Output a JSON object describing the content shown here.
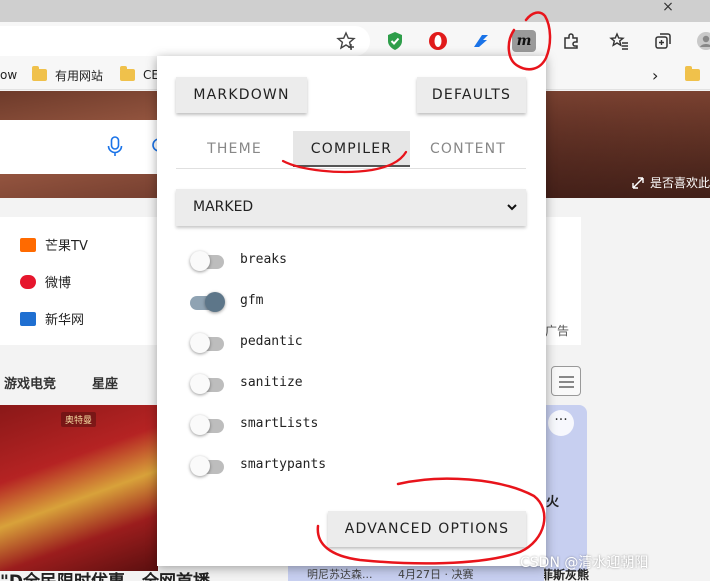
{
  "browser": {
    "tab_close": "×",
    "bookmarks": [
      {
        "label": "ow"
      },
      {
        "label": "有用网站"
      },
      {
        "label": "CE"
      }
    ],
    "overflow": "›"
  },
  "extension": {
    "icon_letter": "m",
    "buttons": {
      "markdown": "MARKDOWN",
      "defaults": "DEFAULTS",
      "advanced": "ADVANCED OPTIONS"
    },
    "tabs": [
      {
        "label": "THEME",
        "active": false
      },
      {
        "label": "COMPILER",
        "active": true
      },
      {
        "label": "CONTENT",
        "active": false
      }
    ],
    "compiler_select": {
      "value": "MARKED"
    },
    "options": [
      {
        "label": "breaks",
        "on": false
      },
      {
        "label": "gfm",
        "on": true
      },
      {
        "label": "pedantic",
        "on": false
      },
      {
        "label": "sanitize",
        "on": false
      },
      {
        "label": "smartLists",
        "on": false
      },
      {
        "label": "smartypants",
        "on": false
      }
    ]
  },
  "page": {
    "hero_caption": "是否喜欢此",
    "sites": [
      {
        "label": "芒果TV",
        "color": "#ff6a00"
      },
      {
        "label": "微博",
        "color": "#e6162d"
      },
      {
        "label": "新华网",
        "color": "#1f6fd1"
      }
    ],
    "ad_label": "广告",
    "nav": [
      "游戏电竞",
      "星座"
    ],
    "photo_tag": "奥特曼",
    "headline": "\"D全民限时优惠，全网首播",
    "right_card": {
      "more": "···",
      "line1": "火",
      "line2": "孟菲斯灰熊"
    },
    "bottom_strip": {
      "left": "明尼苏达森...",
      "right": "4月27日 · 决赛"
    },
    "watermark": "CSDN @清水迎朝阳"
  },
  "colors": {
    "annotation": "#e8141b",
    "toggle_on": "#5d7689",
    "accent_green": "#2e9e4a",
    "accent_red": "#e11b1b",
    "accent_blue": "#1a73e8"
  }
}
